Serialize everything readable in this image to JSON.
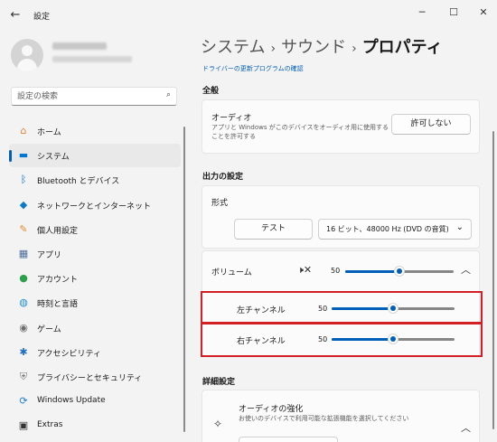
{
  "window": {
    "title": "設定",
    "minimize": "─",
    "maximize": "☐",
    "close": "✕",
    "back": "←"
  },
  "search": {
    "placeholder": "設定の検索",
    "icon": "search-icon"
  },
  "sidebar": {
    "items": [
      {
        "label": "ホーム",
        "icon": "home-icon",
        "glyph": "⌂",
        "color": "#e0833a"
      },
      {
        "label": "システム",
        "icon": "display-icon",
        "glyph": "▬",
        "color": "#0078d4",
        "selected": true
      },
      {
        "label": "Bluetooth とデバイス",
        "icon": "bluetooth-icon",
        "glyph": "ᛒ",
        "color": "#0067c0"
      },
      {
        "label": "ネットワークとインターネット",
        "icon": "wifi-icon",
        "glyph": "◆",
        "color": "#0a79c8"
      },
      {
        "label": "個人用設定",
        "icon": "paintbrush-icon",
        "glyph": "✎",
        "color": "#e08a2f"
      },
      {
        "label": "アプリ",
        "icon": "apps-icon",
        "glyph": "▦",
        "color": "#4a6f9a"
      },
      {
        "label": "アカウント",
        "icon": "account-icon",
        "glyph": "●",
        "color": "#2aa04a"
      },
      {
        "label": "時刻と言語",
        "icon": "globe-clock-icon",
        "glyph": "◍",
        "color": "#1b8fd6"
      },
      {
        "label": "ゲーム",
        "icon": "gamepad-icon",
        "glyph": "◉",
        "color": "#6f6f6f"
      },
      {
        "label": "アクセシビリティ",
        "icon": "accessibility-icon",
        "glyph": "✱",
        "color": "#1f6fc5"
      },
      {
        "label": "プライバシーとセキュリティ",
        "icon": "shield-icon",
        "glyph": "⛨",
        "color": "#7c7c7c"
      },
      {
        "label": "Windows Update",
        "icon": "update-icon",
        "glyph": "⟳",
        "color": "#1e7ed2"
      },
      {
        "label": "Extras",
        "icon": "extras-icon",
        "glyph": "▣",
        "color": "#333333"
      }
    ]
  },
  "breadcrumb": {
    "part1": "システム",
    "part2": "サウンド",
    "current": "プロパティ",
    "sep": "›"
  },
  "driver_link": "ドライバーの更新プログラムの確認",
  "general": {
    "heading": "全般",
    "audio_title": "オーディオ",
    "audio_desc_line1": "アプリと Windows がこのデバイスをオーディオ用に使用する",
    "audio_desc_line2": "ことを許可する",
    "deny_button": "許可しない"
  },
  "output": {
    "heading": "出力の設定",
    "format_label": "形式",
    "test_button": "テスト",
    "format_value": "16 ビット、48000 Hz (DVD の音質)",
    "format_chevron": "⌄",
    "volume_label": "ボリューム",
    "volume_value": "50",
    "volume_level": 0.5,
    "mute_icon": "speaker-mute-icon",
    "collapse_chevron": "︿",
    "left_label": "左チャンネル",
    "left_value": "50",
    "left_level": 0.5,
    "right_label": "右チャンネル",
    "right_value": "50",
    "right_level": 0.5
  },
  "advanced": {
    "heading": "詳細設定",
    "enhance_title": "オーディオの強化",
    "enhance_desc": "お使いのデバイスで利用可能な拡張機能を選択してください",
    "expand_chevron": "︿"
  },
  "colors": {
    "accent": "#005fb8",
    "highlight": "#d31e25"
  }
}
